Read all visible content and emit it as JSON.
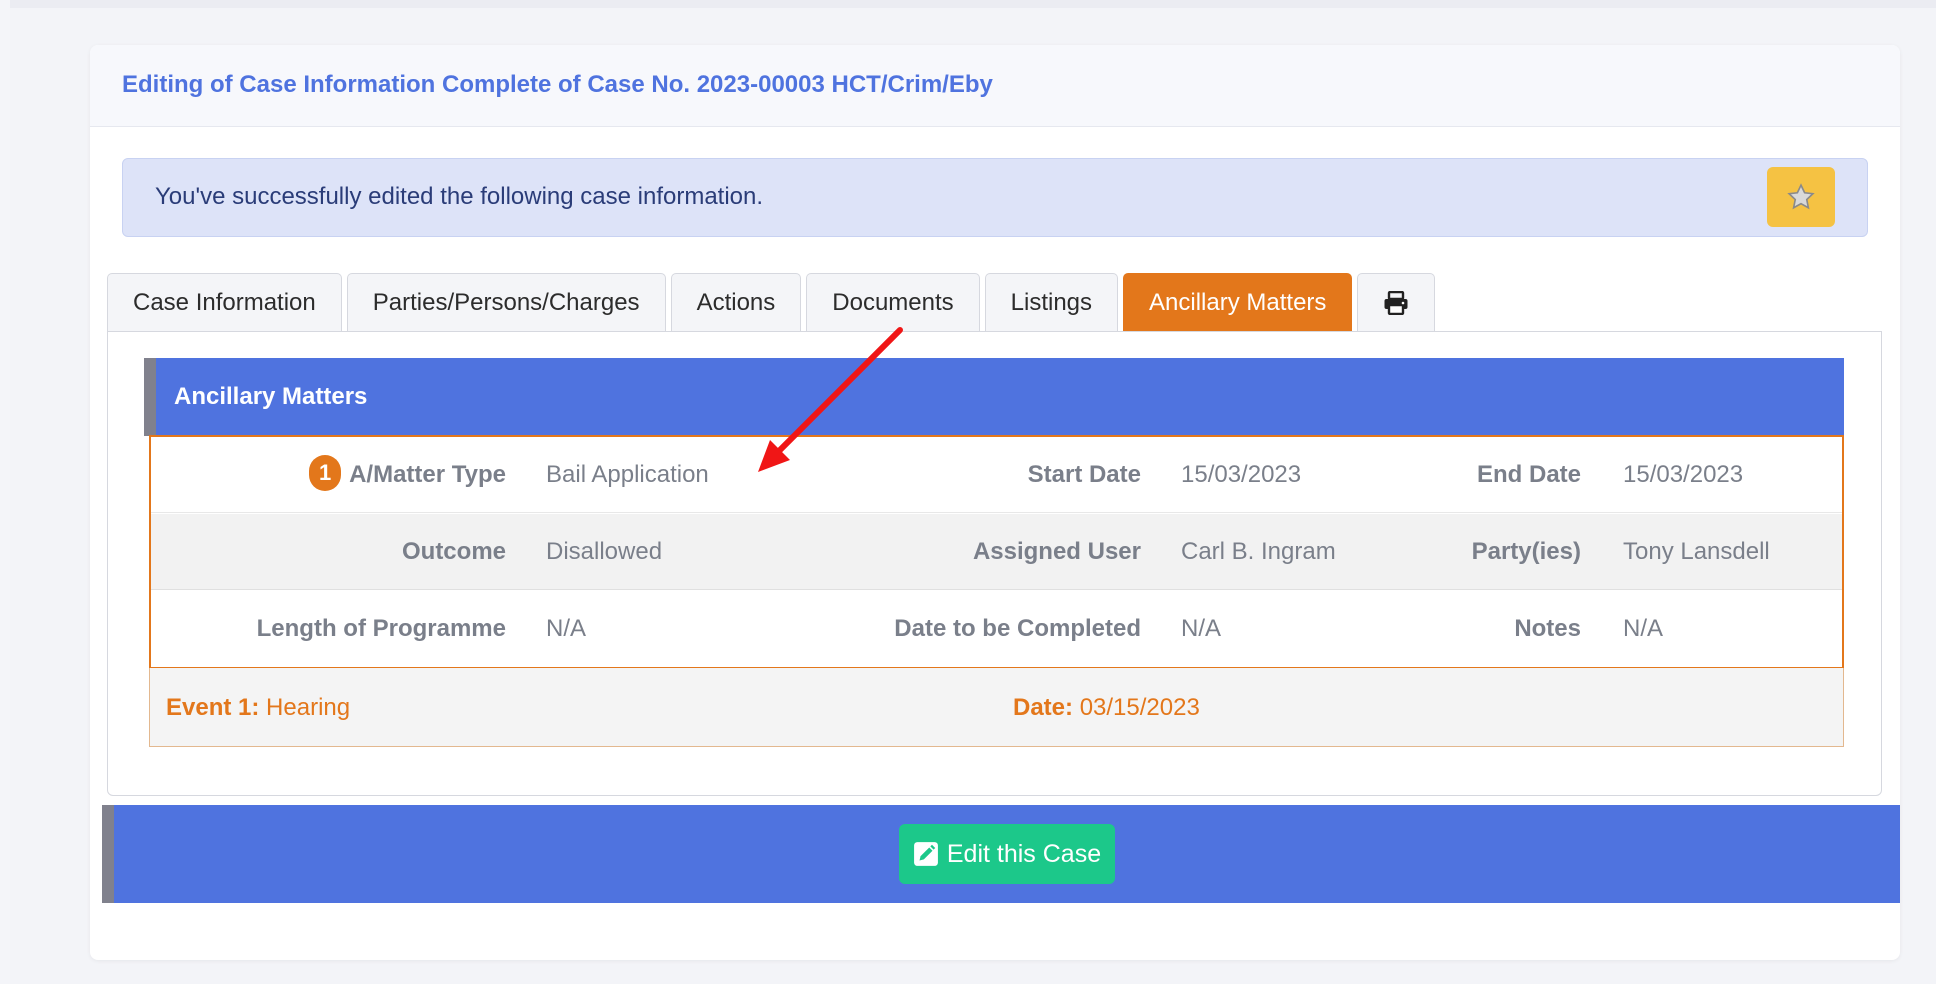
{
  "card": {
    "title": "Editing of Case Information Complete of Case No. 2023-00003 HCT/Crim/Eby"
  },
  "alert": {
    "message": "You've successfully edited the following case information.",
    "button_icon": "star-icon"
  },
  "tabs": [
    {
      "label": "Case Information",
      "active": false
    },
    {
      "label": "Parties/Persons/Charges",
      "active": false
    },
    {
      "label": "Actions",
      "active": false
    },
    {
      "label": "Documents",
      "active": false
    },
    {
      "label": "Listings",
      "active": false
    },
    {
      "label": "Ancillary Matters",
      "active": true
    },
    {
      "label": "",
      "icon": "print-icon",
      "active": false
    }
  ],
  "section": {
    "title": "Ancillary Matters"
  },
  "matter": {
    "badge": "1",
    "rows": [
      [
        {
          "label": "A/Matter Type",
          "value": "Bail Application"
        },
        {
          "label": "Start Date",
          "value": "15/03/2023"
        },
        {
          "label": "End Date",
          "value": "15/03/2023"
        }
      ],
      [
        {
          "label": "Outcome",
          "value": "Disallowed"
        },
        {
          "label": "Assigned User",
          "value": "Carl B. Ingram"
        },
        {
          "label": "Party(ies)",
          "value": "Tony Lansdell"
        }
      ],
      [
        {
          "label": "Length of Programme",
          "value": "N/A"
        },
        {
          "label": "Date to be Completed",
          "value": "N/A"
        },
        {
          "label": "Notes",
          "value": "N/A"
        }
      ]
    ]
  },
  "event": {
    "label": "Event 1:",
    "value": "Hearing",
    "date_label": "Date:",
    "date_value": "03/15/2023"
  },
  "footer": {
    "edit_button": "Edit this Case",
    "edit_icon": "edit-icon"
  },
  "colors": {
    "primary": "#4f73df",
    "accent": "#e3771b",
    "success": "#1cc88a",
    "warning": "#f5c243"
  }
}
